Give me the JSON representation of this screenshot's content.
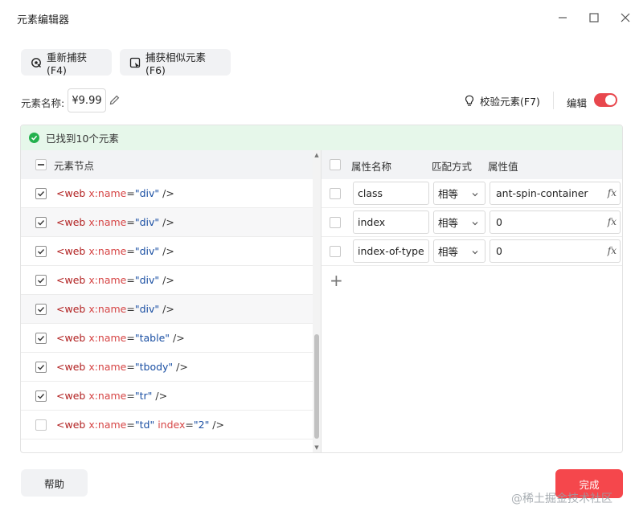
{
  "window": {
    "title": "元素编辑器",
    "minimize_icon": "minimize-icon",
    "maximize_icon": "maximize-icon",
    "close_icon": "close-icon"
  },
  "toolbar": {
    "recapture_label": "重新捕获(F4)",
    "capture_similar_label": "捕获相似元素(F6)"
  },
  "element_name": {
    "label": "元素名称:",
    "value": "¥9.99"
  },
  "validate_label": "校验元素(F7)",
  "edit": {
    "label": "编辑",
    "enabled": true,
    "accent_color": "#e8474d"
  },
  "found_message": "已找到10个元素",
  "nodes": {
    "header": "元素节点",
    "rows": [
      {
        "checked": true,
        "tag": "<web",
        "attr": "x:name",
        "value": "\"div\"",
        "extra_attr": "",
        "extra_value": "",
        "end": " />"
      },
      {
        "checked": true,
        "tag": "<web",
        "attr": "x:name",
        "value": "\"div\"",
        "extra_attr": "",
        "extra_value": "",
        "end": " />"
      },
      {
        "checked": true,
        "tag": "<web",
        "attr": "x:name",
        "value": "\"div\"",
        "extra_attr": "",
        "extra_value": "",
        "end": " />"
      },
      {
        "checked": true,
        "tag": "<web",
        "attr": "x:name",
        "value": "\"div\"",
        "extra_attr": "",
        "extra_value": "",
        "end": " />"
      },
      {
        "checked": true,
        "tag": "<web",
        "attr": "x:name",
        "value": "\"div\"",
        "extra_attr": "",
        "extra_value": "",
        "end": " />"
      },
      {
        "checked": true,
        "tag": "<web",
        "attr": "x:name",
        "value": "\"table\"",
        "extra_attr": "",
        "extra_value": "",
        "end": " />"
      },
      {
        "checked": true,
        "tag": "<web",
        "attr": "x:name",
        "value": "\"tbody\"",
        "extra_attr": "",
        "extra_value": "",
        "end": " />"
      },
      {
        "checked": true,
        "tag": "<web",
        "attr": "x:name",
        "value": "\"tr\"",
        "extra_attr": "",
        "extra_value": "",
        "end": " />"
      },
      {
        "checked": false,
        "tag": "<web",
        "attr": "x:name",
        "value": "\"td\"",
        "extra_attr": "index",
        "extra_value": "\"2\"",
        "end": " />"
      }
    ]
  },
  "attributes": {
    "col_name": "属性名称",
    "col_match": "匹配方式",
    "col_value": "属性值",
    "rows": [
      {
        "name": "class",
        "match": "相等",
        "value": "ant-spin-container"
      },
      {
        "name": "index",
        "match": "相等",
        "value": "0"
      },
      {
        "name": "index-of-type",
        "match": "相等",
        "value": "0"
      }
    ],
    "fx_label": "fx",
    "add_icon": "plus-icon"
  },
  "footer": {
    "help_label": "帮助",
    "done_label": "完成"
  },
  "watermark": "@稀土掘金技术社区"
}
